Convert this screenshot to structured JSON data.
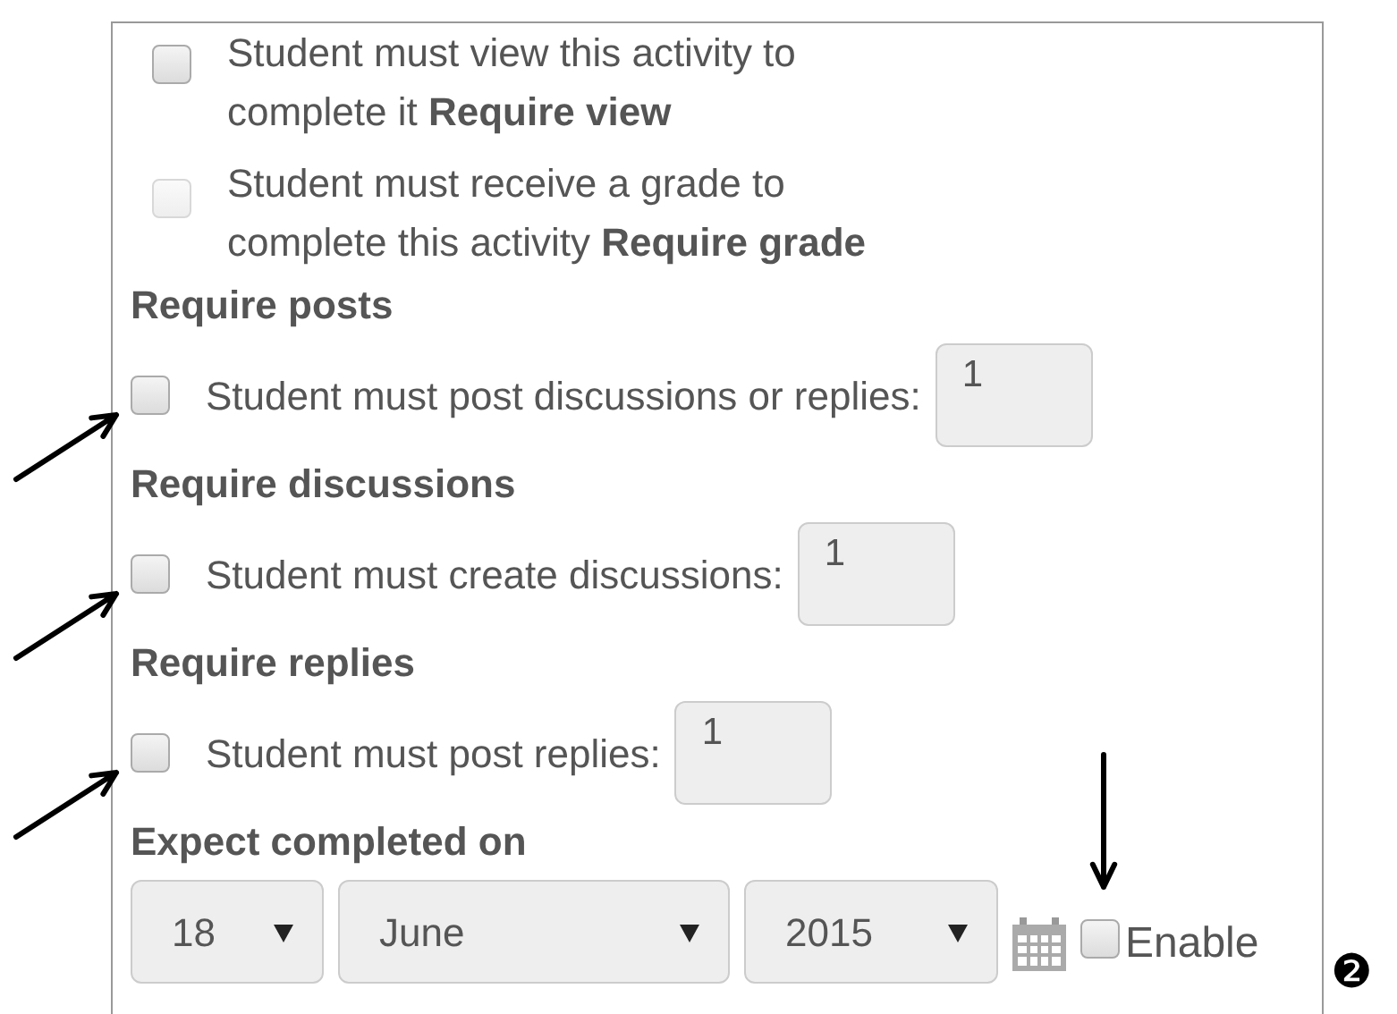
{
  "completion_options": [
    {
      "text": "Student must view this activity to complete it **Require view**",
      "checked": false,
      "disabled": false
    },
    {
      "text": "Student must receive a grade to complete this activity **Require grade**",
      "checked": false,
      "disabled": true
    }
  ],
  "requirements": [
    {
      "heading": "Require posts",
      "label": "Student must post discussions or replies:",
      "checked": false,
      "value": "1"
    },
    {
      "heading": "Require discussions",
      "label": "Student must create discussions:",
      "checked": false,
      "value": "1"
    },
    {
      "heading": "Require replies",
      "label": "Student must post replies:",
      "checked": false,
      "value": "1"
    }
  ],
  "expected_completion": {
    "heading": "Expect completed on",
    "day": "18",
    "month": "June",
    "year": "2015",
    "enable_label": "Enable",
    "enabled": false
  },
  "callout": "❷"
}
